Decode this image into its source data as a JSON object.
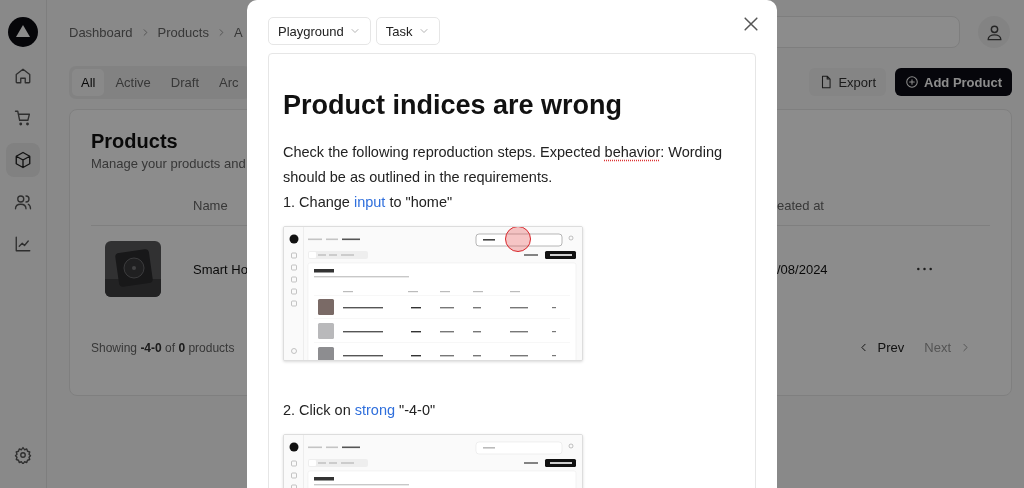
{
  "sidebar": {
    "nav_items": [
      {
        "selected": false
      },
      {
        "selected": false
      },
      {
        "selected": true
      },
      {
        "selected": false
      },
      {
        "selected": false
      }
    ]
  },
  "breadcrumbs": [
    "Dashboard",
    "Products",
    "A"
  ],
  "tabs": [
    {
      "label": "All",
      "selected": true
    },
    {
      "label": "Active",
      "selected": false
    },
    {
      "label": "Draft",
      "selected": false
    },
    {
      "label": "Arc",
      "selected": false
    }
  ],
  "actions": {
    "export": "Export",
    "add": "Add Product"
  },
  "products_card": {
    "title": "Products",
    "subtitle": "Manage your products and",
    "columns": [
      "Name",
      "eated at"
    ],
    "rows": [
      {
        "name": "Smart Ho",
        "created": "/08/2024"
      }
    ],
    "footer": "Showing **-4-0** of **0** products",
    "pagination": [
      {
        "label": "Prev",
        "disabled": false
      },
      {
        "label": "Next",
        "disabled": true
      }
    ]
  },
  "modal": {
    "dropdowns": [
      "Playground",
      "Task"
    ],
    "title": "Product indices are wrong",
    "intro": [
      {
        "text": "Check the following reproduction steps. Expected ",
        "misspelled": false
      },
      {
        "text": "behavior",
        "misspelled": true
      },
      {
        "text": ": Wording should be as outlined in the requirements.",
        "misspelled": false
      }
    ],
    "steps": [
      {
        "parts": [
          {
            "text": "1. Change ",
            "kind": "text"
          },
          {
            "text": "input",
            "kind": "link"
          },
          {
            "text": " to \"home\"",
            "kind": "text"
          }
        ],
        "screenshot": {
          "kind": "picture",
          "click_marker": true
        }
      },
      {
        "parts": [
          {
            "text": "2. Click on ",
            "kind": "text"
          },
          {
            "text": "strong",
            "kind": "link"
          },
          {
            "text": " \"-4-0\"",
            "kind": "text"
          }
        ],
        "screenshot": {
          "kind": "picture"
        }
      }
    ]
  }
}
